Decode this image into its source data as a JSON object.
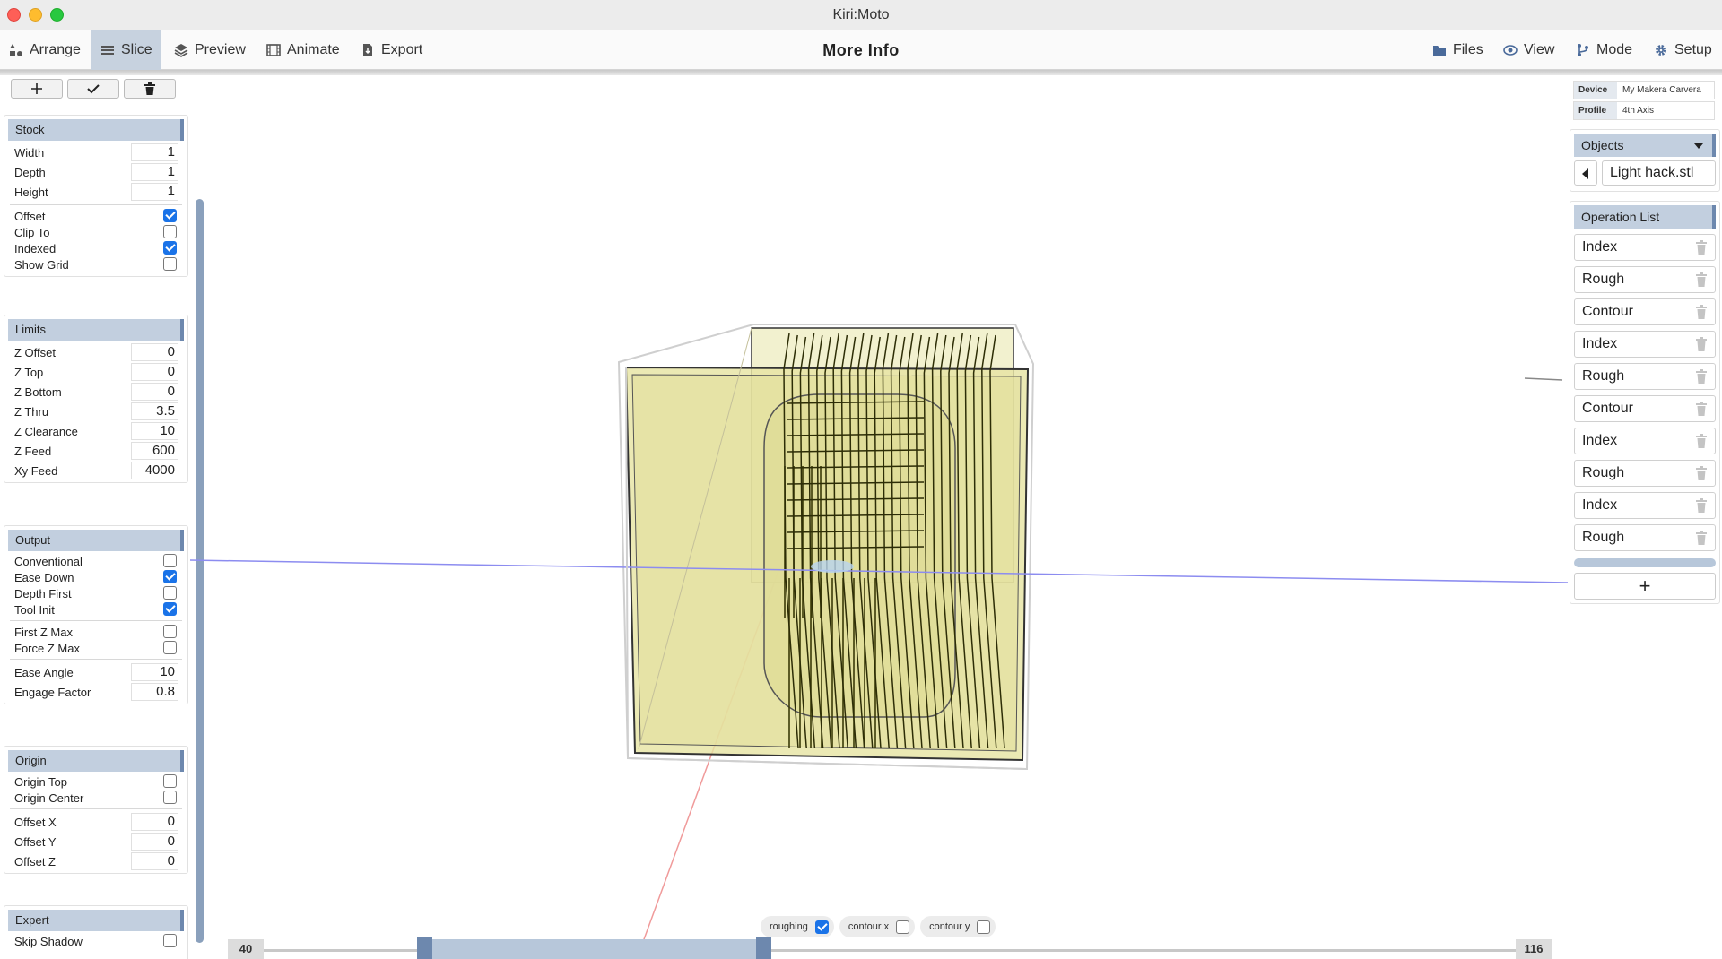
{
  "window": {
    "title": "Kiri:Moto"
  },
  "nav": {
    "left": [
      {
        "label": "Arrange",
        "icon": "shapes-icon"
      },
      {
        "label": "Slice",
        "icon": "list-icon",
        "active": true
      },
      {
        "label": "Preview",
        "icon": "layers-icon"
      },
      {
        "label": "Animate",
        "icon": "film-icon"
      },
      {
        "label": "Export",
        "icon": "file-export-icon"
      }
    ],
    "center": "More Info",
    "right": [
      {
        "label": "Files",
        "icon": "folder-icon"
      },
      {
        "label": "View",
        "icon": "eye-icon"
      },
      {
        "label": "Mode",
        "icon": "branch-icon"
      },
      {
        "label": "Setup",
        "icon": "gear-icon"
      }
    ]
  },
  "left": {
    "toolbar": [
      "add-icon",
      "check-icon",
      "trash-icon"
    ],
    "stock": {
      "title": "Stock",
      "width": {
        "label": "Width",
        "value": "1"
      },
      "depth": {
        "label": "Depth",
        "value": "1"
      },
      "height": {
        "label": "Height",
        "value": "1"
      },
      "offset": {
        "label": "Offset",
        "checked": true
      },
      "clip_to": {
        "label": "Clip To",
        "checked": false
      },
      "indexed": {
        "label": "Indexed",
        "checked": true
      },
      "show_grid": {
        "label": "Show Grid",
        "checked": false
      }
    },
    "limits": {
      "title": "Limits",
      "z_offset": {
        "label": "Z Offset",
        "value": "0"
      },
      "z_top": {
        "label": "Z Top",
        "value": "0"
      },
      "z_bottom": {
        "label": "Z Bottom",
        "value": "0"
      },
      "z_thru": {
        "label": "Z Thru",
        "value": "3.5"
      },
      "z_clearance": {
        "label": "Z Clearance",
        "value": "10"
      },
      "z_feed": {
        "label": "Z Feed",
        "value": "600"
      },
      "xy_feed": {
        "label": "Xy Feed",
        "value": "4000"
      }
    },
    "output": {
      "title": "Output",
      "conventional": {
        "label": "Conventional",
        "checked": false
      },
      "ease_down": {
        "label": "Ease Down",
        "checked": true
      },
      "depth_first": {
        "label": "Depth First",
        "checked": false
      },
      "tool_init": {
        "label": "Tool Init",
        "checked": true
      },
      "first_z_max": {
        "label": "First Z Max",
        "checked": false
      },
      "force_z_max": {
        "label": "Force Z Max",
        "checked": false
      },
      "ease_angle": {
        "label": "Ease Angle",
        "value": "10"
      },
      "engage_factor": {
        "label": "Engage Factor",
        "value": "0.8"
      }
    },
    "origin": {
      "title": "Origin",
      "origin_top": {
        "label": "Origin Top",
        "checked": false
      },
      "origin_center": {
        "label": "Origin Center",
        "checked": false
      },
      "offset_x": {
        "label": "Offset X",
        "value": "0"
      },
      "offset_y": {
        "label": "Offset Y",
        "value": "0"
      },
      "offset_z": {
        "label": "Offset Z",
        "value": "0"
      }
    },
    "expert": {
      "title": "Expert",
      "skip_shadow": {
        "label": "Skip Shadow",
        "checked": false
      }
    }
  },
  "right": {
    "device": {
      "key": "Device",
      "value": "My Makera Carvera"
    },
    "profile": {
      "key": "Profile",
      "value": "4th Axis"
    },
    "objects": {
      "title": "Objects",
      "selected": "Light hack.stl"
    },
    "operations": {
      "title": "Operation List",
      "items": [
        "Index",
        "Rough",
        "Contour",
        "Index",
        "Rough",
        "Contour",
        "Index",
        "Rough",
        "Index",
        "Rough"
      ],
      "add_label": "+"
    }
  },
  "bottom": {
    "toggles": [
      {
        "label": "roughing",
        "checked": true
      },
      {
        "label": "contour x",
        "checked": false
      },
      {
        "label": "contour y",
        "checked": false
      }
    ],
    "slider": {
      "min_label": "40",
      "max_label": "116"
    }
  },
  "colors": {
    "accent": "#6d88ae",
    "header_bg": "#c2cfdf",
    "model_fill": "#e6e3a1",
    "toolpath": "#3a3a08",
    "axis_x": "#8c8cf0",
    "axis_y": "#f08c8c"
  }
}
